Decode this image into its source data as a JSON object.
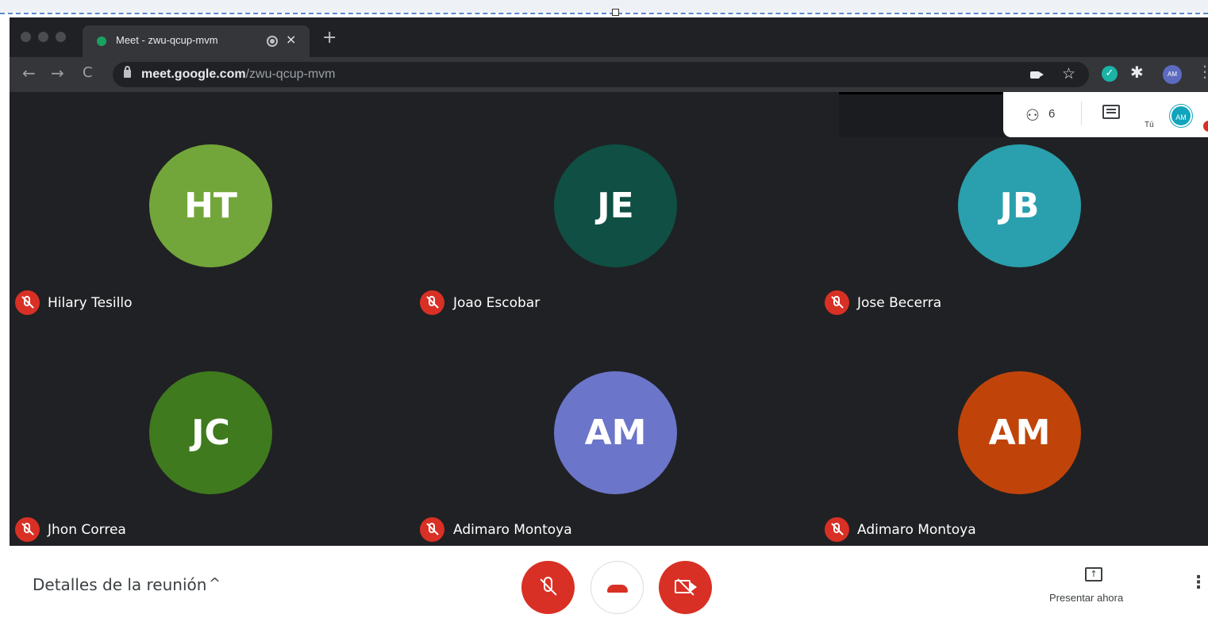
{
  "browser": {
    "tab_title": "Meet - zwu-qcup-mvm",
    "tab_close": "×",
    "new_tab": "+",
    "url_host": "meet.google.com",
    "url_path": "/zwu-qcup-mvm",
    "profile_initials": "AM",
    "nav": {
      "back": "←",
      "forward": "→",
      "reload": "C"
    }
  },
  "meet": {
    "participant_count": "6",
    "you_label": "Tú",
    "self_initials": "AM",
    "participants": [
      {
        "initials": "HT",
        "name": "Hilary Tesillo",
        "color": "#73a63a",
        "muted": true
      },
      {
        "initials": "JE",
        "name": "Joao Escobar",
        "color": "#0f4f44",
        "muted": true
      },
      {
        "initials": "JB",
        "name": "Jose Becerra",
        "color": "#2a9fad",
        "muted": true
      },
      {
        "initials": "JC",
        "name": "Jhon Correa",
        "color": "#3f7a1e",
        "muted": true
      },
      {
        "initials": "AM",
        "name": "Adimaro Montoya",
        "color": "#6b75c9",
        "muted": true
      },
      {
        "initials": "AM",
        "name": "Adimaro Montoya",
        "color": "#c0440a",
        "muted": true
      }
    ],
    "bottom_bar": {
      "details_label": "Detalles de la reunión",
      "present_label": "Presentar ahora"
    }
  },
  "colors": {
    "meet_background": "#202124",
    "danger": "#d93025",
    "browser_chrome": "#35363a"
  }
}
